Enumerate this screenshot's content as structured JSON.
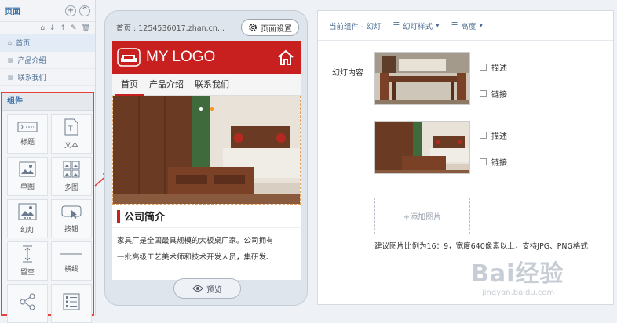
{
  "left_panel": {
    "title": "页面",
    "add_symbol": "+",
    "collapse_symbol": "^",
    "pages": [
      {
        "label": "首页",
        "active": true
      },
      {
        "label": "产品介绍",
        "active": false
      },
      {
        "label": "联系我们",
        "active": false
      }
    ],
    "components_title": "组件",
    "components": [
      {
        "label": "标题",
        "icon": "title-icon"
      },
      {
        "label": "文本",
        "icon": "text-icon"
      },
      {
        "label": "单图",
        "icon": "single-image-icon"
      },
      {
        "label": "多图",
        "icon": "multi-image-icon"
      },
      {
        "label": "幻灯",
        "icon": "slideshow-icon"
      },
      {
        "label": "按钮",
        "icon": "button-icon"
      },
      {
        "label": "留空",
        "icon": "spacer-icon"
      },
      {
        "label": "横线",
        "icon": "divider-icon"
      },
      {
        "label": "",
        "icon": "share-icon"
      },
      {
        "label": "",
        "icon": "list-icon"
      }
    ]
  },
  "phone": {
    "url": "首页 : 1254536017.zhan.cn...",
    "settings_label": "页面设置",
    "logo_text": "MY LOGO",
    "nav": [
      "首页",
      "产品介绍",
      "联系我们"
    ],
    "section_title": "公司简介",
    "paragraph_line1": "家具厂是全国最具规模的大板桌厂家。公司拥有",
    "paragraph_line2": "一批高级工艺美术师和技术开发人员，集研发、",
    "preview_label": "预览"
  },
  "right_panel": {
    "current_component": "当前组件 - 幻灯",
    "style_dropdown": "幻灯样式",
    "height_dropdown": "高度",
    "content_label": "幻灯内容",
    "describe_label": "描述",
    "link_label": "链接",
    "add_image_label": "+添加图片",
    "hint": "建议图片比例为16：9，宽度640像素以上，支持JPG、PNG格式"
  },
  "watermark": {
    "brand": "Bai经验",
    "url": "jingyan.baidu.com"
  },
  "colors": {
    "brand_red": "#c8201f",
    "highlight_red": "#e8413b",
    "link_blue": "#4d6f95"
  }
}
